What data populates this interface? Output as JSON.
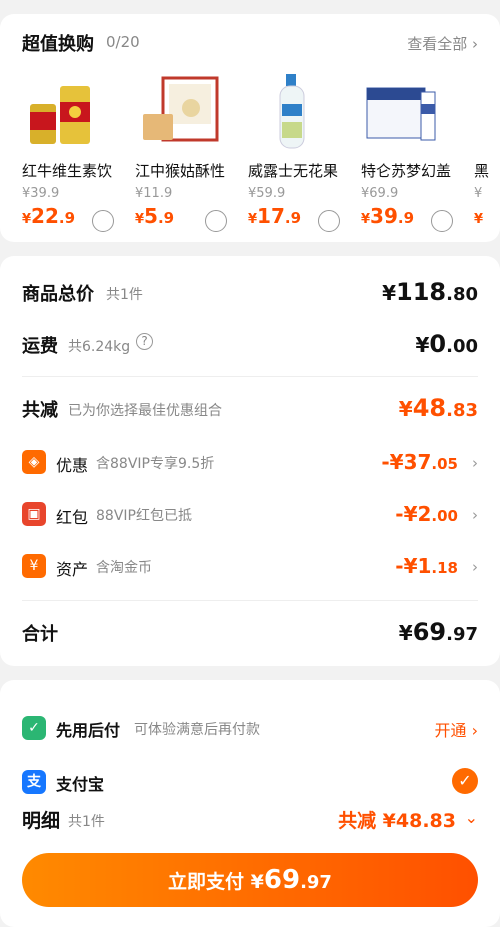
{
  "swap": {
    "title": "超值换购",
    "count": "0/20",
    "view_all": "查看全部 ›",
    "products": [
      {
        "name": "红牛维生素饮",
        "orig_price": "¥39.9",
        "currency": "¥",
        "price_int": "22",
        "price_dec": ".9"
      },
      {
        "name": "江中猴姑酥性",
        "orig_price": "¥11.9",
        "currency": "¥",
        "price_int": "5",
        "price_dec": ".9"
      },
      {
        "name": "威露士无花果",
        "orig_price": "¥59.9",
        "currency": "¥",
        "price_int": "17",
        "price_dec": ".9"
      },
      {
        "name": "特仑苏梦幻盖",
        "orig_price": "¥69.9",
        "currency": "¥",
        "price_int": "39",
        "price_dec": ".9"
      },
      {
        "name": "黑",
        "orig_price": "¥",
        "currency": "¥",
        "price_int": "",
        "price_dec": ""
      }
    ]
  },
  "price": {
    "goods_label": "商品总价",
    "goods_sub": "共1件",
    "goods_cur": "¥",
    "goods_int": "118",
    "goods_dec": ".80",
    "ship_label": "运费",
    "ship_sub": "共6.24kg",
    "ship_cur": "¥",
    "ship_int": "0",
    "ship_dec": ".00",
    "reduce_label": "共减",
    "reduce_sub": "已为你选择最佳优惠组合",
    "reduce_cur": "¥",
    "reduce_int": "48",
    "reduce_dec": ".83",
    "discounts": [
      {
        "icon": "tag-icon",
        "icon_char": "◈",
        "color": "#ff6a00",
        "label": "优惠",
        "sub": "含88VIP专享9.5折",
        "value_int": "-¥37",
        "value_dec": ".05"
      },
      {
        "icon": "red-packet-icon",
        "icon_char": "▣",
        "color": "#e8452c",
        "label": "红包",
        "sub": "88VIP红包已抵",
        "value_int": "-¥2",
        "value_dec": ".00"
      },
      {
        "icon": "yuan-icon",
        "icon_char": "¥",
        "color": "#ff6a00",
        "label": "资产",
        "sub": "含淘金币",
        "value_int": "-¥1",
        "value_dec": ".18"
      }
    ],
    "total_label": "合计",
    "total_cur": "¥",
    "total_int": "69",
    "total_dec": ".97"
  },
  "payment": {
    "bnpl_label": "先用后付",
    "bnpl_sub": "可体验满意后再付款",
    "bnpl_action": "开通 ›",
    "alipay_label": "支付宝",
    "detail_label": "明细",
    "detail_sub": "共1件",
    "detail_total": "共减 ¥48.83",
    "button_prefix": "立即支付 ¥",
    "button_int": "69",
    "button_dec": ".97"
  }
}
